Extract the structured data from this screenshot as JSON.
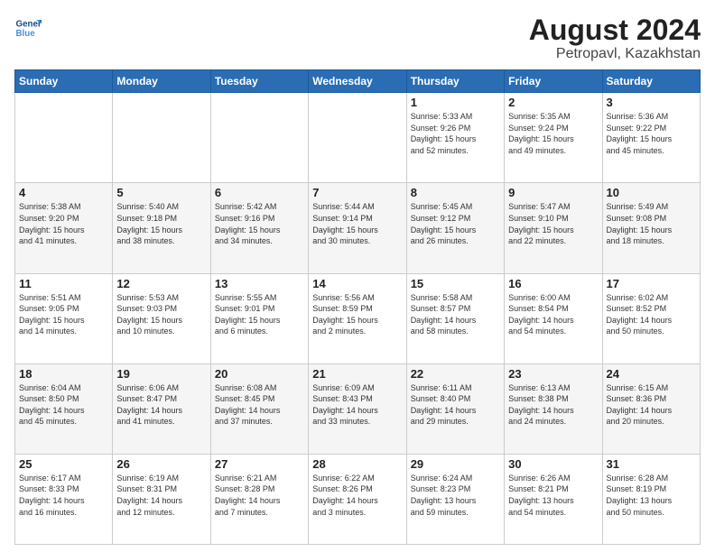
{
  "header": {
    "logo_line1": "General",
    "logo_line2": "Blue",
    "title": "August 2024",
    "subtitle": "Petropavl, Kazakhstan"
  },
  "days_of_week": [
    "Sunday",
    "Monday",
    "Tuesday",
    "Wednesday",
    "Thursday",
    "Friday",
    "Saturday"
  ],
  "weeks": [
    [
      {
        "day": "",
        "info": ""
      },
      {
        "day": "",
        "info": ""
      },
      {
        "day": "",
        "info": ""
      },
      {
        "day": "",
        "info": ""
      },
      {
        "day": "1",
        "info": "Sunrise: 5:33 AM\nSunset: 9:26 PM\nDaylight: 15 hours\nand 52 minutes."
      },
      {
        "day": "2",
        "info": "Sunrise: 5:35 AM\nSunset: 9:24 PM\nDaylight: 15 hours\nand 49 minutes."
      },
      {
        "day": "3",
        "info": "Sunrise: 5:36 AM\nSunset: 9:22 PM\nDaylight: 15 hours\nand 45 minutes."
      }
    ],
    [
      {
        "day": "4",
        "info": "Sunrise: 5:38 AM\nSunset: 9:20 PM\nDaylight: 15 hours\nand 41 minutes."
      },
      {
        "day": "5",
        "info": "Sunrise: 5:40 AM\nSunset: 9:18 PM\nDaylight: 15 hours\nand 38 minutes."
      },
      {
        "day": "6",
        "info": "Sunrise: 5:42 AM\nSunset: 9:16 PM\nDaylight: 15 hours\nand 34 minutes."
      },
      {
        "day": "7",
        "info": "Sunrise: 5:44 AM\nSunset: 9:14 PM\nDaylight: 15 hours\nand 30 minutes."
      },
      {
        "day": "8",
        "info": "Sunrise: 5:45 AM\nSunset: 9:12 PM\nDaylight: 15 hours\nand 26 minutes."
      },
      {
        "day": "9",
        "info": "Sunrise: 5:47 AM\nSunset: 9:10 PM\nDaylight: 15 hours\nand 22 minutes."
      },
      {
        "day": "10",
        "info": "Sunrise: 5:49 AM\nSunset: 9:08 PM\nDaylight: 15 hours\nand 18 minutes."
      }
    ],
    [
      {
        "day": "11",
        "info": "Sunrise: 5:51 AM\nSunset: 9:05 PM\nDaylight: 15 hours\nand 14 minutes."
      },
      {
        "day": "12",
        "info": "Sunrise: 5:53 AM\nSunset: 9:03 PM\nDaylight: 15 hours\nand 10 minutes."
      },
      {
        "day": "13",
        "info": "Sunrise: 5:55 AM\nSunset: 9:01 PM\nDaylight: 15 hours\nand 6 minutes."
      },
      {
        "day": "14",
        "info": "Sunrise: 5:56 AM\nSunset: 8:59 PM\nDaylight: 15 hours\nand 2 minutes."
      },
      {
        "day": "15",
        "info": "Sunrise: 5:58 AM\nSunset: 8:57 PM\nDaylight: 14 hours\nand 58 minutes."
      },
      {
        "day": "16",
        "info": "Sunrise: 6:00 AM\nSunset: 8:54 PM\nDaylight: 14 hours\nand 54 minutes."
      },
      {
        "day": "17",
        "info": "Sunrise: 6:02 AM\nSunset: 8:52 PM\nDaylight: 14 hours\nand 50 minutes."
      }
    ],
    [
      {
        "day": "18",
        "info": "Sunrise: 6:04 AM\nSunset: 8:50 PM\nDaylight: 14 hours\nand 45 minutes."
      },
      {
        "day": "19",
        "info": "Sunrise: 6:06 AM\nSunset: 8:47 PM\nDaylight: 14 hours\nand 41 minutes."
      },
      {
        "day": "20",
        "info": "Sunrise: 6:08 AM\nSunset: 8:45 PM\nDaylight: 14 hours\nand 37 minutes."
      },
      {
        "day": "21",
        "info": "Sunrise: 6:09 AM\nSunset: 8:43 PM\nDaylight: 14 hours\nand 33 minutes."
      },
      {
        "day": "22",
        "info": "Sunrise: 6:11 AM\nSunset: 8:40 PM\nDaylight: 14 hours\nand 29 minutes."
      },
      {
        "day": "23",
        "info": "Sunrise: 6:13 AM\nSunset: 8:38 PM\nDaylight: 14 hours\nand 24 minutes."
      },
      {
        "day": "24",
        "info": "Sunrise: 6:15 AM\nSunset: 8:36 PM\nDaylight: 14 hours\nand 20 minutes."
      }
    ],
    [
      {
        "day": "25",
        "info": "Sunrise: 6:17 AM\nSunset: 8:33 PM\nDaylight: 14 hours\nand 16 minutes."
      },
      {
        "day": "26",
        "info": "Sunrise: 6:19 AM\nSunset: 8:31 PM\nDaylight: 14 hours\nand 12 minutes."
      },
      {
        "day": "27",
        "info": "Sunrise: 6:21 AM\nSunset: 8:28 PM\nDaylight: 14 hours\nand 7 minutes."
      },
      {
        "day": "28",
        "info": "Sunrise: 6:22 AM\nSunset: 8:26 PM\nDaylight: 14 hours\nand 3 minutes."
      },
      {
        "day": "29",
        "info": "Sunrise: 6:24 AM\nSunset: 8:23 PM\nDaylight: 13 hours\nand 59 minutes."
      },
      {
        "day": "30",
        "info": "Sunrise: 6:26 AM\nSunset: 8:21 PM\nDaylight: 13 hours\nand 54 minutes."
      },
      {
        "day": "31",
        "info": "Sunrise: 6:28 AM\nSunset: 8:19 PM\nDaylight: 13 hours\nand 50 minutes."
      }
    ]
  ]
}
